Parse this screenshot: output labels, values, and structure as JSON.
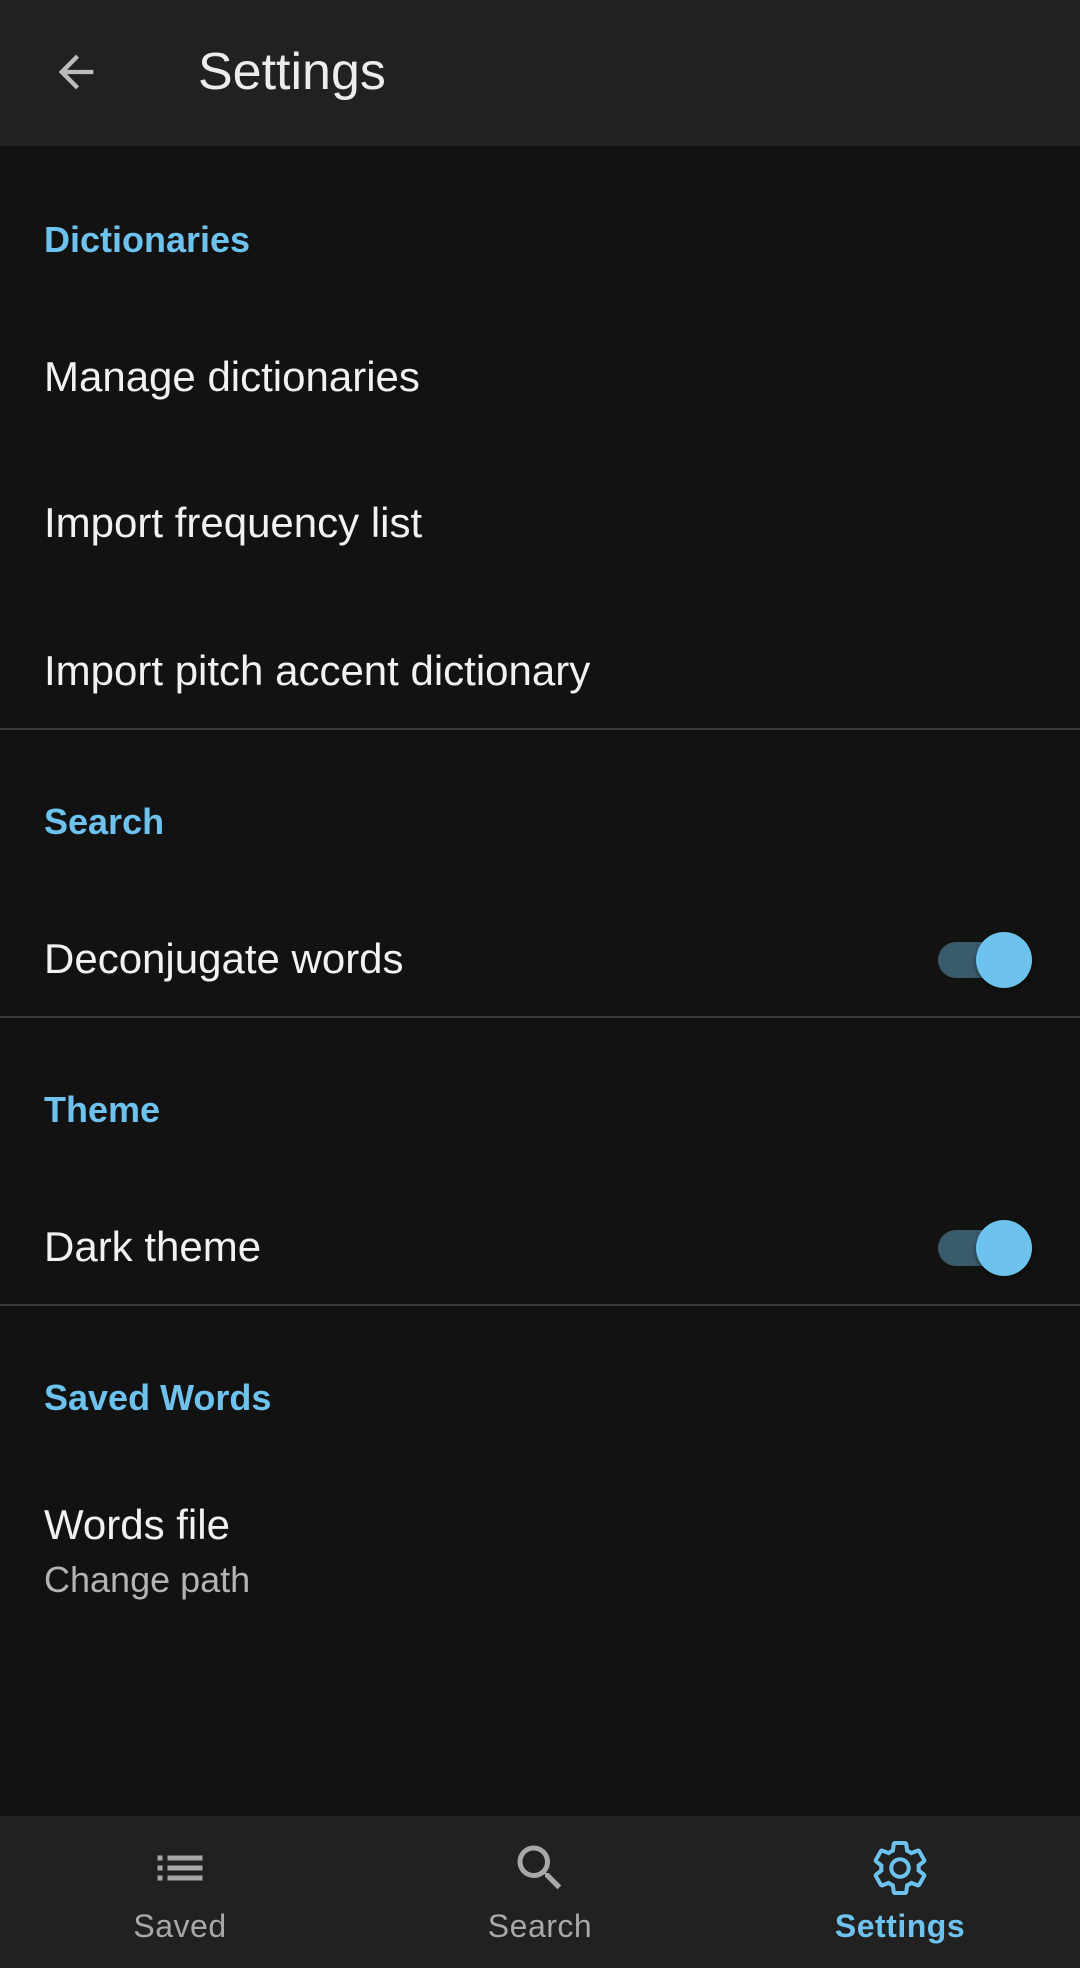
{
  "appbar": {
    "title": "Settings",
    "back_icon": "arrow-back-icon"
  },
  "sections": {
    "dictionaries": {
      "header": "Dictionaries",
      "manage": "Manage dictionaries",
      "import_frequency": "Import frequency list",
      "import_pitch": "Import pitch accent dictionary"
    },
    "search": {
      "header": "Search",
      "deconjugate": "Deconjugate words",
      "deconjugate_on": true
    },
    "theme": {
      "header": "Theme",
      "dark": "Dark theme",
      "dark_on": true
    },
    "saved_words": {
      "header": "Saved Words",
      "words_file": "Words file",
      "words_file_sub": "Change path"
    }
  },
  "bottom_nav": {
    "items": [
      {
        "label": "Saved",
        "icon": "list-icon",
        "active": false
      },
      {
        "label": "Search",
        "icon": "search-icon",
        "active": false
      },
      {
        "label": "Settings",
        "icon": "gear-icon",
        "active": true
      }
    ]
  },
  "colors": {
    "accent": "#6ec3ee",
    "background": "#121212",
    "bar": "#212121"
  }
}
